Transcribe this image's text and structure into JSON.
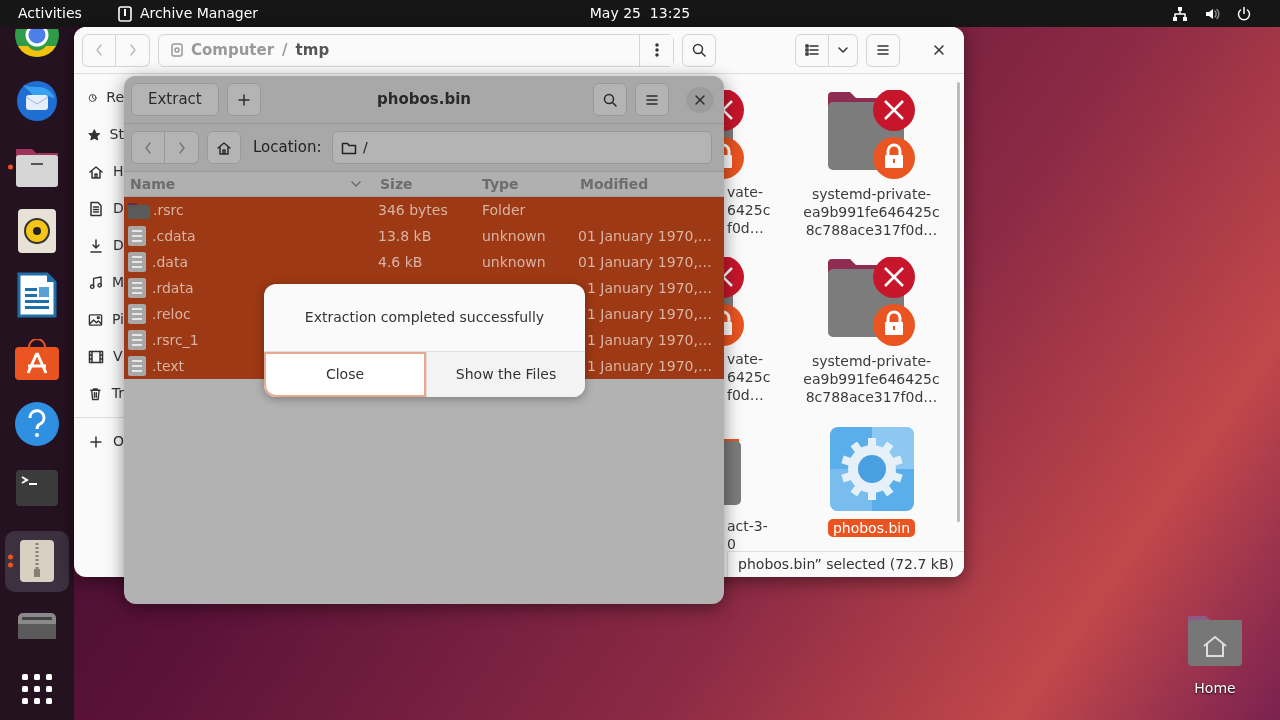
{
  "top_bar": {
    "activities": "Activities",
    "app_name": "Archive Manager",
    "clock": "May 25  13:25"
  },
  "dock": [
    {
      "kind": "browser",
      "running": false,
      "active": false
    },
    {
      "kind": "mail",
      "running": false,
      "active": false
    },
    {
      "kind": "files",
      "running": true,
      "multi_window": false,
      "active": false
    },
    {
      "kind": "music",
      "running": false,
      "active": false
    },
    {
      "kind": "writer",
      "running": false,
      "active": false
    },
    {
      "kind": "store",
      "running": false,
      "active": false
    },
    {
      "kind": "help",
      "running": false,
      "active": false
    },
    {
      "kind": "terminal",
      "running": false,
      "active": false
    },
    {
      "kind": "archive",
      "running": true,
      "multi_window": true,
      "active": true
    },
    {
      "kind": "drive",
      "running": false,
      "active": false
    },
    {
      "kind": "apps",
      "running": false,
      "active": false
    }
  ],
  "files_window": {
    "path": [
      "Computer",
      "tmp"
    ],
    "path_separator": "/",
    "sidebar": [
      {
        "kind": "recent",
        "label": "Re"
      },
      {
        "kind": "starred",
        "label": "St"
      },
      {
        "kind": "home",
        "label": "H"
      },
      {
        "kind": "documents",
        "label": "D"
      },
      {
        "kind": "downloads",
        "label": "D"
      },
      {
        "kind": "music",
        "label": "M"
      },
      {
        "kind": "pictures",
        "label": "Pi"
      },
      {
        "kind": "videos",
        "label": "V"
      },
      {
        "kind": "trash",
        "label": "Tr"
      },
      {
        "kind": "other",
        "label": "O"
      }
    ],
    "items": [
      {
        "kind": "locked_folder",
        "partial": true,
        "selected": false,
        "label_lines": [
          "vate-",
          "6425c",
          "f0d…"
        ]
      },
      {
        "kind": "locked_folder",
        "partial": false,
        "selected": false,
        "label_lines": [
          "systemd-private-",
          "ea9b991fe646425c",
          "8c788ace317f0d…"
        ]
      },
      {
        "kind": "locked_folder",
        "partial": true,
        "selected": false,
        "label_lines": [
          "vate-",
          "6425c",
          "f0d…"
        ]
      },
      {
        "kind": "locked_folder",
        "partial": false,
        "selected": false,
        "label_lines": [
          "systemd-private-",
          "ea9b991fe646425c",
          "8c788ace317f0d…"
        ]
      },
      {
        "kind": "folder",
        "partial": true,
        "selected": false,
        "label_lines": [
          "act-3-",
          "0"
        ]
      },
      {
        "kind": "executable",
        "partial": false,
        "selected": true,
        "label_lines": [
          "phobos.bin"
        ]
      }
    ],
    "status": "phobos.bin” selected (72.7 kB)"
  },
  "archive_window": {
    "extract": "Extract",
    "title": "phobos.bin",
    "location_label": "Location:",
    "location": "/",
    "columns": [
      "Name",
      "Size",
      "Type",
      "Modified"
    ],
    "rows": [
      {
        "kind": "folder",
        "selected": true,
        "name": ".rsrc",
        "size": "346 bytes",
        "type": "Folder"
      },
      {
        "kind": "binary",
        "selected": true,
        "name": ".cdata",
        "size": "13.8 kB",
        "type": "unknown",
        "modified": "01 January 1970,…"
      },
      {
        "kind": "binary",
        "selected": true,
        "name": ".data",
        "size": "4.6 kB",
        "type": "unknown",
        "modified": "01 January 1970,…"
      },
      {
        "kind": "binary",
        "selected": true,
        "name": ".rdata",
        "modified": "1 January 1970,…"
      },
      {
        "kind": "binary",
        "selected": true,
        "name": ".reloc",
        "modified": "1 January 1970,…"
      },
      {
        "kind": "binary",
        "selected": true,
        "name": ".rsrc_1",
        "modified": "1 January 1970,…"
      },
      {
        "kind": "binary",
        "selected": true,
        "name": ".text",
        "modified": "1 January 1970,…"
      }
    ]
  },
  "dialog": {
    "message": "Extraction completed successfully",
    "buttons": [
      {
        "label": "Close",
        "focused": true
      },
      {
        "label": "Show the Files",
        "focused": false
      }
    ]
  },
  "desktop_icons": [
    {
      "label": "Home"
    }
  ]
}
